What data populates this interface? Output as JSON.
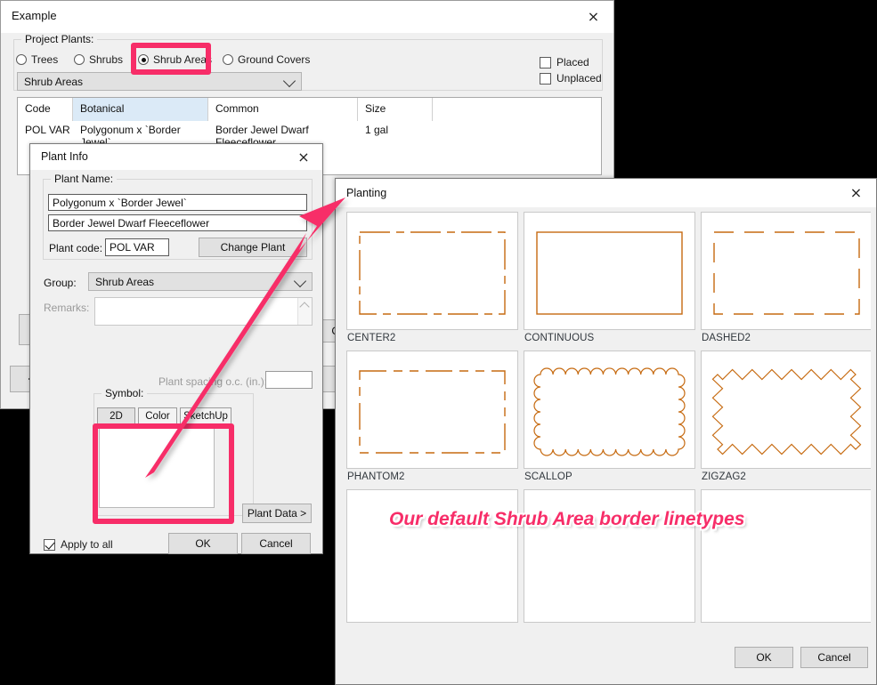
{
  "backdrop": {
    "color": "#000000"
  },
  "accent": {
    "pink": "#F72D68",
    "linetype_orange": "#C66A10",
    "selection_blue": "#dbeaf7"
  },
  "example_window": {
    "title": "Example",
    "close_label": "×",
    "project_plants": {
      "legend": "Project Plants:",
      "radios": [
        {
          "label": "Trees",
          "checked": false
        },
        {
          "label": "Shrubs",
          "checked": false
        },
        {
          "label": "Shrub Areas",
          "checked": true
        },
        {
          "label": "Ground Covers",
          "checked": false
        }
      ],
      "checkboxes": [
        {
          "label": "Placed",
          "checked": false
        },
        {
          "label": "Unplaced",
          "checked": false
        }
      ],
      "group_combo_value": "Shrub Areas"
    },
    "grid": {
      "columns": [
        "Code",
        "Botanical",
        "Common",
        "Size",
        ""
      ],
      "selected_column": "Botanical",
      "rows": [
        {
          "code": "POL VAR",
          "botanical": "Polygonum x `Border Jewel`",
          "common": "Border Jewel Dwarf Fleeceflower",
          "size": "1 gal",
          "extra": ""
        }
      ]
    },
    "hidden_buttons": [
      {
        "label": "<"
      },
      {
        "label": "Co"
      }
    ]
  },
  "plant_info": {
    "title": "Plant Info",
    "close_label": "×",
    "plant_name": {
      "legend": "Plant Name:",
      "botanical_value": "Polygonum x `Border Jewel`",
      "common_value": "Border Jewel Dwarf Fleeceflower",
      "plant_code_label": "Plant code:",
      "plant_code_value": "POL VAR",
      "change_plant_label": "Change Plant"
    },
    "group_label": "Group:",
    "group_value": "Shrub Areas",
    "remarks_label": "Remarks:",
    "remarks_value": "",
    "plant_spacing_label": "Plant spacing o.c. (in.):",
    "plant_spacing_value": "",
    "symbol": {
      "legend": "Symbol:",
      "tabs": [
        {
          "label": "2D",
          "active": true
        },
        {
          "label": "Color",
          "active": false
        },
        {
          "label": "SketchUp",
          "active": false
        }
      ]
    },
    "plant_data_label": "Plant Data >",
    "apply_to_all": {
      "label": "Apply to all",
      "checked": true
    },
    "ok_label": "OK",
    "cancel_label": "Cancel"
  },
  "planting_dialog": {
    "title": "Planting",
    "close_label": "×",
    "tiles": [
      {
        "name": "CENTER2",
        "pattern": "center2"
      },
      {
        "name": "CONTINUOUS",
        "pattern": "continuous"
      },
      {
        "name": "DASHED2",
        "pattern": "dashed2"
      },
      {
        "name": "PHANTOM2",
        "pattern": "phantom2"
      },
      {
        "name": "SCALLOP",
        "pattern": "scallop"
      },
      {
        "name": "ZIGZAG2",
        "pattern": "zigzag2"
      },
      {
        "name": "",
        "pattern": "blank"
      },
      {
        "name": "",
        "pattern": "blank"
      },
      {
        "name": "",
        "pattern": "blank"
      }
    ],
    "ok_label": "OK",
    "cancel_label": "Cancel"
  },
  "annotation": {
    "text": "Our default Shrub Area border linetypes"
  }
}
